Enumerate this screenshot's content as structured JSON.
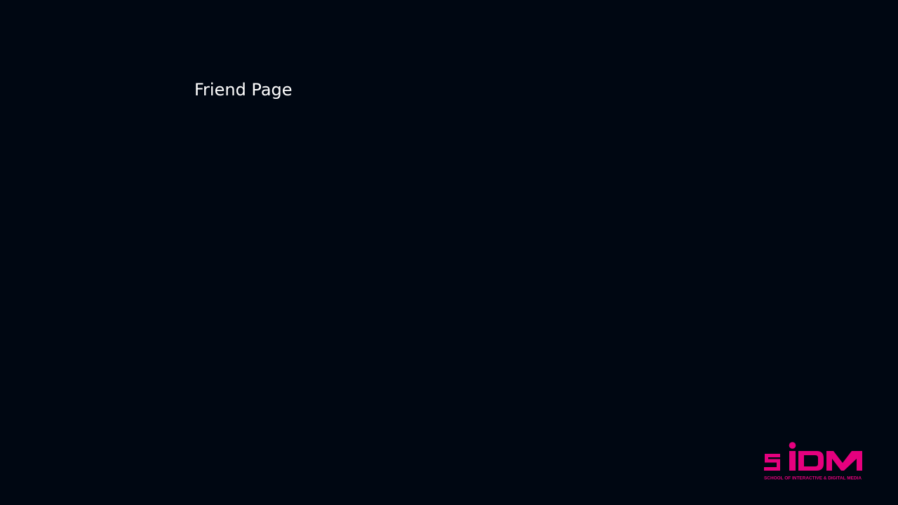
{
  "slide": {
    "title": "Friend Page",
    "background_color": "#000712",
    "title_color": "#ffffff"
  },
  "logo": {
    "wordmark": "SiDM",
    "tagline": "SCHOOL OF INTERACTIVE & DIGITAL MEDIA",
    "color": "#e6007e"
  }
}
